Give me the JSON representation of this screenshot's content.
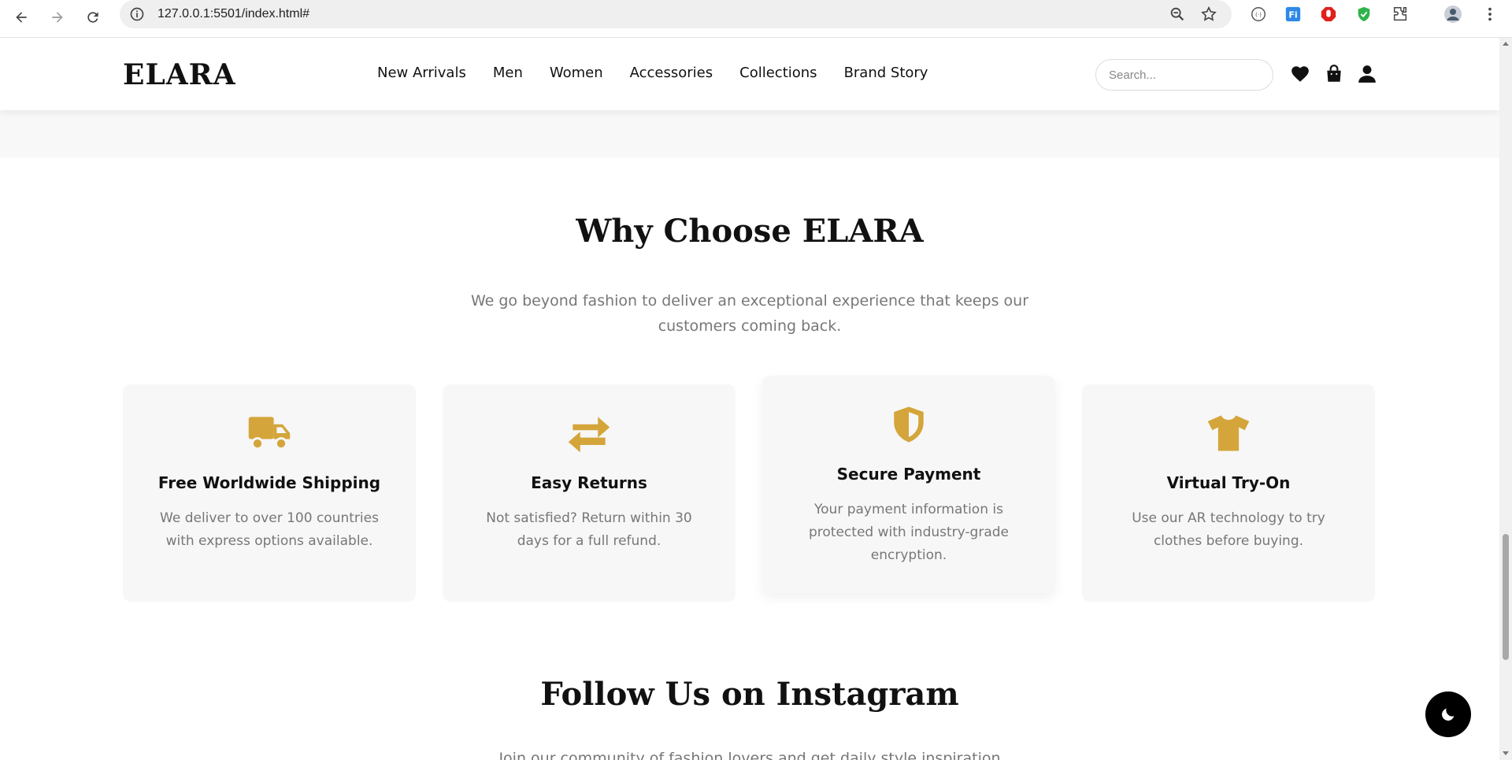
{
  "browser": {
    "url": "127.0.0.1:5501/index.html#",
    "icons": [
      "back-icon",
      "forward-icon",
      "reload-icon",
      "site-info-icon",
      "zoom-icon",
      "bookmark-star-icon",
      "extension-icon",
      "extension-icon",
      "extension-icon",
      "extension-icon",
      "puzzle-icon",
      "profile-icon",
      "menu-icon"
    ]
  },
  "header": {
    "logo": "ELARA",
    "nav": [
      "New Arrivals",
      "Men",
      "Women",
      "Accessories",
      "Collections",
      "Brand Story"
    ],
    "search_placeholder": "Search...",
    "icons": [
      "heart-icon",
      "bag-icon",
      "user-icon"
    ]
  },
  "why": {
    "title": "Why Choose ELARA",
    "subtitle": "We go beyond fashion to deliver an exceptional experience that keeps our customers coming back.",
    "cards": [
      {
        "icon": "truck-icon",
        "title": "Free Worldwide Shipping",
        "desc": "We deliver to over 100 countries with express options available."
      },
      {
        "icon": "exchange-icon",
        "title": "Easy Returns",
        "desc": "Not satisfied? Return within 30 days for a full refund."
      },
      {
        "icon": "shield-icon",
        "title": "Secure Payment",
        "desc": "Your payment information is protected with industry-grade encryption."
      },
      {
        "icon": "tshirt-icon",
        "title": "Virtual Try-On",
        "desc": "Use our AR technology to try clothes before buying."
      }
    ]
  },
  "instagram": {
    "title": "Follow Us on Instagram",
    "subtitle": "Join our community of fashion lovers and get daily style inspiration"
  },
  "colors": {
    "accent": "#d4a53a",
    "text": "#111111",
    "muted": "#777777",
    "card_bg": "#f7f7f7"
  }
}
